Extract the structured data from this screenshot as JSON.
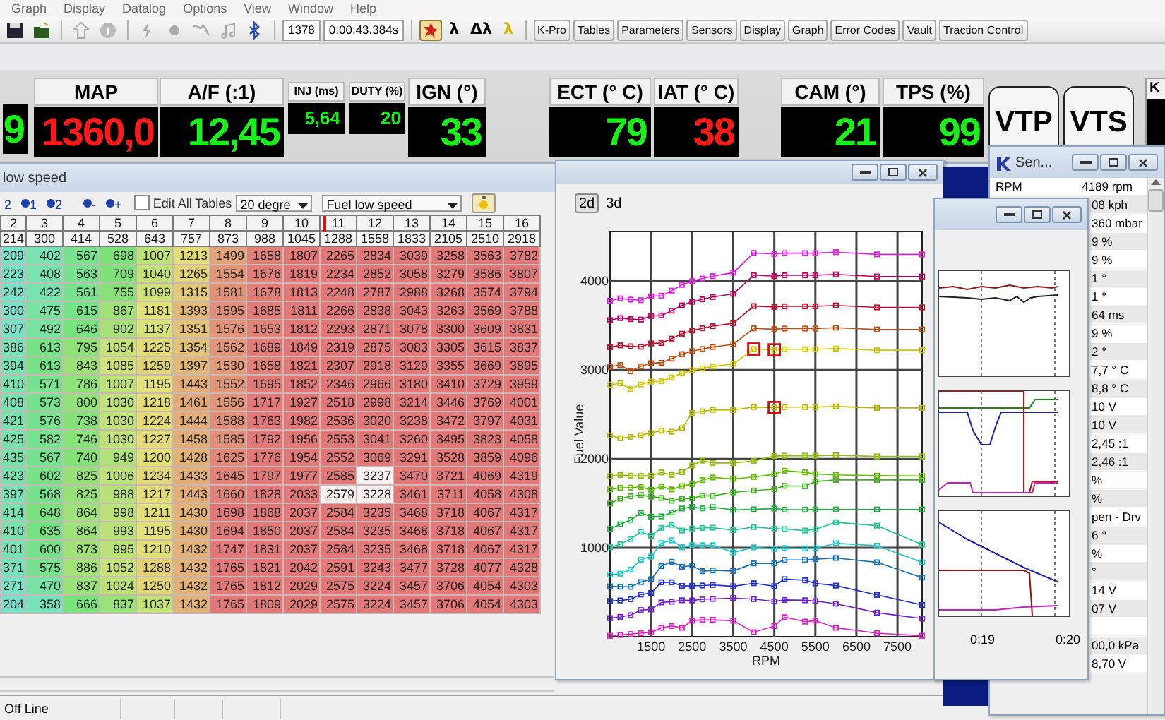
{
  "menu": [
    "Graph",
    "Display",
    "Datalog",
    "Options",
    "View",
    "Window",
    "Help"
  ],
  "toolbar": {
    "counter": "1378",
    "elapsed": "0:00:43.384s",
    "toggle": {
      "selected": true
    },
    "modes": [
      {
        "label": "λ",
        "color": "#000000"
      },
      {
        "label": "Δλ",
        "color": "#000000"
      },
      {
        "label": "λ",
        "color": "#d8b800"
      }
    ],
    "buttons": [
      "K-Pro",
      "Tables",
      "Parameters",
      "Sensors",
      "Display",
      "Graph",
      "Error Codes",
      "Vault",
      "Traction Control"
    ]
  },
  "gauges": [
    {
      "kind": "partial",
      "value": "9",
      "alarm": false
    },
    {
      "kind": "large",
      "label": "MAP",
      "value": "1360,0",
      "alarm": true
    },
    {
      "kind": "large",
      "label": "A/F (:1)",
      "value": "12,45",
      "alarm": false
    },
    {
      "kind": "small",
      "label": "INJ (ms)",
      "value": "5,64",
      "alarm": false
    },
    {
      "kind": "small",
      "label": "DUTY (%)",
      "value": "20",
      "alarm": false
    },
    {
      "kind": "large",
      "label": "IGN (°)",
      "value": "33",
      "alarm": false
    },
    {
      "kind": "large",
      "label": "ECT (° C)",
      "value": "79",
      "alarm": false
    },
    {
      "kind": "large",
      "label": "IAT (° C)",
      "value": "38",
      "alarm": true
    },
    {
      "kind": "large",
      "label": "CAM (°)",
      "value": "21",
      "alarm": false
    },
    {
      "kind": "large",
      "label": "TPS (%)",
      "value": "99",
      "alarm": false
    }
  ],
  "indicators": [
    "VTP",
    "VTS"
  ],
  "indicator_partial": "K",
  "table_window": {
    "title": "low speed",
    "markers": [
      {
        "kind": "partial",
        "label": "2"
      },
      {
        "kind": "marker",
        "label": "1"
      },
      {
        "kind": "marker",
        "label": "2"
      },
      {
        "kind": "marker",
        "label": "-"
      },
      {
        "kind": "marker",
        "label": "+"
      }
    ],
    "edit_all": {
      "label": "Edit All Tables",
      "checked": false
    },
    "angle_select": "20 degre",
    "table_select": "Fuel low speed",
    "columns": [
      {
        "label": "2",
        "load": "214",
        "cursor": false
      },
      {
        "label": "3",
        "load": "300",
        "cursor": false
      },
      {
        "label": "4",
        "load": "414",
        "cursor": false
      },
      {
        "label": "5",
        "load": "528",
        "cursor": false
      },
      {
        "label": "6",
        "load": "643",
        "cursor": false
      },
      {
        "label": "7",
        "load": "757",
        "cursor": false
      },
      {
        "label": "8",
        "load": "873",
        "cursor": false
      },
      {
        "label": "9",
        "load": "988",
        "cursor": false
      },
      {
        "label": "10",
        "load": "1045",
        "cursor": false
      },
      {
        "label": "11",
        "load": "1288",
        "cursor": true
      },
      {
        "label": "12",
        "load": "1558",
        "cursor": false
      },
      {
        "label": "13",
        "load": "1833",
        "cursor": false
      },
      {
        "label": "14",
        "load": "2105",
        "cursor": false
      },
      {
        "label": "15",
        "load": "2510",
        "cursor": false
      },
      {
        "label": "16",
        "load": "2918",
        "cursor": false
      }
    ],
    "rows": [
      {
        "values": [
          "209",
          "402",
          "567",
          "698",
          "1007",
          "1213",
          "1499",
          "1658",
          "1807",
          "2265",
          "2834",
          "3039",
          "3258",
          "3563",
          "3782"
        ],
        "selected": [
          false,
          false,
          false,
          false,
          false,
          false,
          false,
          false,
          false,
          false,
          false,
          false,
          false,
          false,
          false
        ]
      },
      {
        "values": [
          "223",
          "408",
          "563",
          "709",
          "1040",
          "1265",
          "1554",
          "1676",
          "1819",
          "2234",
          "2852",
          "3058",
          "3279",
          "3586",
          "3807"
        ],
        "selected": [
          false,
          false,
          false,
          false,
          false,
          false,
          false,
          false,
          false,
          false,
          false,
          false,
          false,
          false,
          false
        ]
      },
      {
        "values": [
          "242",
          "422",
          "561",
          "755",
          "1099",
          "1315",
          "1581",
          "1678",
          "1813",
          "2248",
          "2787",
          "2988",
          "3268",
          "3574",
          "3794"
        ],
        "selected": [
          false,
          false,
          false,
          false,
          false,
          false,
          false,
          false,
          false,
          false,
          false,
          false,
          false,
          false,
          false
        ]
      },
      {
        "values": [
          "300",
          "475",
          "615",
          "867",
          "1181",
          "1393",
          "1595",
          "1685",
          "1811",
          "2266",
          "2838",
          "3043",
          "3263",
          "3569",
          "3788"
        ],
        "selected": [
          false,
          false,
          false,
          false,
          false,
          false,
          false,
          false,
          false,
          false,
          false,
          false,
          false,
          false,
          false
        ]
      },
      {
        "values": [
          "307",
          "492",
          "646",
          "902",
          "1137",
          "1351",
          "1576",
          "1653",
          "1812",
          "2293",
          "2871",
          "3078",
          "3300",
          "3609",
          "3831"
        ],
        "selected": [
          false,
          false,
          false,
          false,
          false,
          false,
          false,
          false,
          false,
          false,
          false,
          false,
          false,
          false,
          false
        ]
      },
      {
        "values": [
          "386",
          "613",
          "795",
          "1054",
          "1225",
          "1354",
          "1562",
          "1689",
          "1849",
          "2319",
          "2875",
          "3083",
          "3305",
          "3615",
          "3837"
        ],
        "selected": [
          false,
          false,
          false,
          false,
          false,
          false,
          false,
          false,
          false,
          false,
          false,
          false,
          false,
          false,
          false
        ]
      },
      {
        "values": [
          "394",
          "613",
          "843",
          "1085",
          "1259",
          "1397",
          "1530",
          "1658",
          "1821",
          "2307",
          "2918",
          "3129",
          "3355",
          "3669",
          "3895"
        ],
        "selected": [
          false,
          false,
          false,
          false,
          false,
          false,
          false,
          false,
          false,
          false,
          false,
          false,
          false,
          false,
          false
        ]
      },
      {
        "values": [
          "410",
          "571",
          "786",
          "1007",
          "1195",
          "1443",
          "1552",
          "1695",
          "1852",
          "2346",
          "2966",
          "3180",
          "3410",
          "3729",
          "3959"
        ],
        "selected": [
          false,
          false,
          false,
          false,
          false,
          false,
          false,
          false,
          false,
          false,
          false,
          false,
          false,
          false,
          false
        ]
      },
      {
        "values": [
          "408",
          "573",
          "800",
          "1030",
          "1218",
          "1461",
          "1556",
          "1717",
          "1927",
          "2518",
          "2998",
          "3214",
          "3446",
          "3769",
          "4001"
        ],
        "selected": [
          false,
          false,
          false,
          false,
          false,
          false,
          false,
          false,
          false,
          false,
          false,
          false,
          false,
          false,
          false
        ]
      },
      {
        "values": [
          "421",
          "576",
          "738",
          "1030",
          "1224",
          "1444",
          "1588",
          "1763",
          "1982",
          "2536",
          "3020",
          "3238",
          "3472",
          "3797",
          "4031"
        ],
        "selected": [
          false,
          false,
          false,
          false,
          false,
          false,
          false,
          false,
          false,
          false,
          false,
          false,
          false,
          false,
          false
        ]
      },
      {
        "values": [
          "425",
          "582",
          "746",
          "1030",
          "1227",
          "1458",
          "1585",
          "1792",
          "1956",
          "2553",
          "3041",
          "3260",
          "3495",
          "3823",
          "4058"
        ],
        "selected": [
          false,
          false,
          false,
          false,
          false,
          false,
          false,
          false,
          false,
          false,
          false,
          false,
          false,
          false,
          false
        ]
      },
      {
        "values": [
          "435",
          "567",
          "740",
          "949",
          "1200",
          "1428",
          "1625",
          "1776",
          "1954",
          "2552",
          "3069",
          "3291",
          "3528",
          "3859",
          "4096"
        ],
        "selected": [
          false,
          false,
          false,
          false,
          false,
          false,
          false,
          false,
          false,
          false,
          false,
          false,
          false,
          false,
          false
        ]
      },
      {
        "values": [
          "423",
          "602",
          "825",
          "1006",
          "1234",
          "1433",
          "1645",
          "1797",
          "1977",
          "2585",
          "3237",
          "3470",
          "3721",
          "4069",
          "4319"
        ],
        "selected": [
          false,
          false,
          false,
          false,
          false,
          false,
          false,
          false,
          false,
          false,
          true,
          false,
          false,
          false,
          false
        ]
      },
      {
        "values": [
          "397",
          "568",
          "825",
          "988",
          "1217",
          "1443",
          "1660",
          "1828",
          "2033",
          "2579",
          "3228",
          "3461",
          "3711",
          "4058",
          "4308"
        ],
        "selected": [
          false,
          false,
          false,
          false,
          false,
          false,
          false,
          false,
          false,
          true,
          true,
          false,
          false,
          false,
          false
        ]
      },
      {
        "values": [
          "414",
          "648",
          "864",
          "998",
          "1211",
          "1430",
          "1698",
          "1868",
          "2037",
          "2584",
          "3235",
          "3468",
          "3718",
          "4067",
          "4317"
        ],
        "selected": [
          false,
          false,
          false,
          false,
          false,
          false,
          false,
          false,
          false,
          false,
          false,
          false,
          false,
          false,
          false
        ]
      },
      {
        "values": [
          "410",
          "635",
          "864",
          "993",
          "1195",
          "1430",
          "1694",
          "1850",
          "2037",
          "2584",
          "3235",
          "3468",
          "3718",
          "4067",
          "4317"
        ],
        "selected": [
          false,
          false,
          false,
          false,
          false,
          false,
          false,
          false,
          false,
          false,
          false,
          false,
          false,
          false,
          false
        ]
      },
      {
        "values": [
          "401",
          "600",
          "873",
          "995",
          "1210",
          "1432",
          "1747",
          "1831",
          "2037",
          "2584",
          "3235",
          "3468",
          "3718",
          "4067",
          "4317"
        ],
        "selected": [
          false,
          false,
          false,
          false,
          false,
          false,
          false,
          false,
          false,
          false,
          false,
          false,
          false,
          false,
          false
        ]
      },
      {
        "values": [
          "371",
          "575",
          "886",
          "1052",
          "1288",
          "1432",
          "1765",
          "1821",
          "2042",
          "2591",
          "3243",
          "3477",
          "3728",
          "4077",
          "4328"
        ],
        "selected": [
          false,
          false,
          false,
          false,
          false,
          false,
          false,
          false,
          false,
          false,
          false,
          false,
          false,
          false,
          false
        ]
      },
      {
        "values": [
          "271",
          "470",
          "837",
          "1024",
          "1250",
          "1432",
          "1765",
          "1812",
          "2029",
          "2575",
          "3224",
          "3457",
          "3706",
          "4054",
          "4303"
        ],
        "selected": [
          false,
          false,
          false,
          false,
          false,
          false,
          false,
          false,
          false,
          false,
          false,
          false,
          false,
          false,
          false
        ]
      },
      {
        "values": [
          "204",
          "358",
          "666",
          "837",
          "1037",
          "1432",
          "1765",
          "1809",
          "2029",
          "2575",
          "3224",
          "3457",
          "3706",
          "4054",
          "4303"
        ],
        "selected": [
          false,
          false,
          false,
          false,
          false,
          false,
          false,
          false,
          false,
          false,
          false,
          false,
          false,
          false,
          false
        ]
      }
    ]
  },
  "chart_window": {
    "view_modes": [
      {
        "label": "2d",
        "selected": true
      },
      {
        "label": "3d",
        "selected": false
      }
    ],
    "chart_data": {
      "type": "line",
      "xlabel": "RPM",
      "ylabel": "Fuel Value",
      "x": [
        500,
        750,
        1000,
        1250,
        1500,
        1750,
        2000,
        2250,
        2500,
        2750,
        3000,
        3500,
        4000,
        4500,
        4750,
        5250,
        5500,
        6000,
        7000,
        8100
      ],
      "xlim": [
        500,
        8100
      ],
      "grid": true,
      "ylim": [
        0,
        4560
      ],
      "xticks": [
        1500,
        2500,
        3500,
        4500,
        5500,
        6500,
        7500
      ],
      "yticks": [
        1000,
        2000,
        3000,
        4000
      ],
      "series": [
        {
          "marker": "square",
          "color": "#e020c0",
          "values": [
            10,
            20,
            30,
            40,
            50,
            100,
            120,
            100,
            180,
            190,
            190,
            180,
            50,
            120,
            220,
            170,
            180,
            100,
            40,
            10
          ]
        },
        {
          "marker": "square",
          "color": "#7020d0",
          "values": [
            209,
            223,
            242,
            300,
            307,
            386,
            394,
            410,
            408,
            421,
            425,
            435,
            423,
            397,
            414,
            410,
            401,
            371,
            271,
            204
          ]
        },
        {
          "marker": "square",
          "color": "#2030d0",
          "values": [
            402,
            408,
            422,
            475,
            492,
            613,
            613,
            571,
            573,
            576,
            582,
            567,
            602,
            568,
            648,
            635,
            600,
            575,
            470,
            358
          ]
        },
        {
          "marker": "square",
          "color": "#1a70b8",
          "values": [
            567,
            563,
            561,
            615,
            646,
            795,
            843,
            786,
            800,
            738,
            746,
            740,
            825,
            825,
            864,
            864,
            873,
            886,
            837,
            666
          ]
        },
        {
          "marker": "square",
          "color": "#20c8c8",
          "values": [
            698,
            709,
            755,
            867,
            902,
            1054,
            1085,
            1007,
            1030,
            1030,
            1030,
            949,
            1006,
            988,
            998,
            993,
            995,
            1052,
            1024,
            837
          ]
        },
        {
          "marker": "square",
          "color": "#20c898",
          "values": [
            1007,
            1040,
            1099,
            1181,
            1137,
            1225,
            1259,
            1195,
            1218,
            1224,
            1227,
            1200,
            1234,
            1217,
            1211,
            1195,
            1210,
            1288,
            1250,
            1037
          ]
        },
        {
          "marker": "square",
          "color": "#20b040",
          "values": [
            1213,
            1265,
            1315,
            1393,
            1351,
            1354,
            1397,
            1443,
            1461,
            1444,
            1458,
            1428,
            1433,
            1443,
            1430,
            1430,
            1432,
            1432,
            1432,
            1432
          ]
        },
        {
          "marker": "square",
          "color": "#40b020",
          "values": [
            1499,
            1554,
            1581,
            1595,
            1576,
            1562,
            1530,
            1552,
            1556,
            1588,
            1585,
            1625,
            1645,
            1660,
            1698,
            1694,
            1747,
            1765,
            1765,
            1765
          ]
        },
        {
          "marker": "square",
          "color": "#60c000",
          "values": [
            1658,
            1676,
            1678,
            1685,
            1653,
            1689,
            1658,
            1695,
            1717,
            1763,
            1792,
            1776,
            1797,
            1828,
            1868,
            1850,
            1831,
            1821,
            1812,
            1809
          ]
        },
        {
          "marker": "square",
          "color": "#90c000",
          "values": [
            1807,
            1819,
            1813,
            1811,
            1812,
            1849,
            1821,
            1852,
            1927,
            1982,
            1956,
            1954,
            1977,
            2033,
            2037,
            2037,
            2037,
            2042,
            2029,
            2029
          ]
        },
        {
          "marker": "square",
          "color": "#b8b800",
          "values": [
            2265,
            2234,
            2248,
            2266,
            2293,
            2319,
            2307,
            2346,
            2518,
            2536,
            2553,
            2552,
            2585,
            2579,
            2584,
            2584,
            2584,
            2591,
            2575,
            2575
          ]
        },
        {
          "marker": "square",
          "color": "#d0c800",
          "values": [
            2834,
            2852,
            2787,
            2838,
            2871,
            2875,
            2918,
            2966,
            2998,
            3020,
            3041,
            3069,
            3237,
            3228,
            3235,
            3235,
            3235,
            3243,
            3224,
            3224
          ]
        },
        {
          "marker": "square",
          "color": "#c05010",
          "values": [
            3039,
            3058,
            2988,
            3043,
            3078,
            3083,
            3129,
            3180,
            3214,
            3238,
            3260,
            3291,
            3470,
            3461,
            3468,
            3468,
            3468,
            3477,
            3457,
            3457
          ]
        },
        {
          "marker": "square",
          "color": "#c01030",
          "values": [
            3258,
            3279,
            3268,
            3263,
            3300,
            3305,
            3355,
            3410,
            3446,
            3472,
            3495,
            3528,
            3721,
            3711,
            3718,
            3718,
            3718,
            3728,
            3706,
            3706
          ]
        },
        {
          "marker": "square",
          "color": "#c00060",
          "values": [
            3563,
            3586,
            3574,
            3569,
            3609,
            3615,
            3669,
            3729,
            3769,
            3797,
            3823,
            3859,
            4069,
            4058,
            4067,
            4067,
            4067,
            4077,
            4054,
            4054
          ]
        },
        {
          "marker": "square",
          "color": "#e020e0",
          "values": [
            3782,
            3807,
            3794,
            3788,
            3831,
            3837,
            3895,
            3959,
            4001,
            4031,
            4058,
            4096,
            4319,
            4308,
            4317,
            4317,
            4317,
            4328,
            4303,
            4303
          ]
        }
      ]
    }
  },
  "datalog_window": {
    "time_labels": [
      "0:19",
      "0:20"
    ]
  },
  "sensors_window": {
    "title": "Sen...",
    "rows": [
      {
        "kind": "full",
        "label": "RPM",
        "value": "4189 rpm"
      },
      {
        "kind": "covered",
        "value": "08 kph"
      },
      {
        "kind": "covered",
        "value": "360 mbar"
      },
      {
        "kind": "covered",
        "value": "9 %"
      },
      {
        "kind": "covered",
        "value": "9 %"
      },
      {
        "kind": "covered",
        "value": "1 °"
      },
      {
        "kind": "covered",
        "value": "1 °"
      },
      {
        "kind": "covered",
        "value": "64 ms"
      },
      {
        "kind": "covered",
        "value": "9 %"
      },
      {
        "kind": "covered",
        "value": "2 °"
      },
      {
        "kind": "covered",
        "value": "7,7 ° C"
      },
      {
        "kind": "covered",
        "value": "8,8 ° C"
      },
      {
        "kind": "covered",
        "value": "10 V"
      },
      {
        "kind": "covered",
        "value": "10 V"
      },
      {
        "kind": "covered",
        "value": "2,45 :1"
      },
      {
        "kind": "covered",
        "value": "2,46 :1"
      },
      {
        "kind": "covered",
        "value": "%"
      },
      {
        "kind": "covered",
        "value": "%"
      },
      {
        "kind": "covered",
        "value": "pen - Drv"
      },
      {
        "kind": "covered",
        "value": "6 °"
      },
      {
        "kind": "covered",
        "value": "%"
      },
      {
        "kind": "covered",
        "value": "°"
      },
      {
        "kind": "covered",
        "value": "14 V"
      },
      {
        "kind": "covered",
        "value": "07 V"
      },
      {
        "kind": "covered"
      },
      {
        "kind": "covered",
        "value": "00,0 kPa"
      },
      {
        "kind": "covered",
        "value": "8,70 V"
      }
    ]
  },
  "status_bar": {
    "items": [
      "Off Line"
    ]
  }
}
